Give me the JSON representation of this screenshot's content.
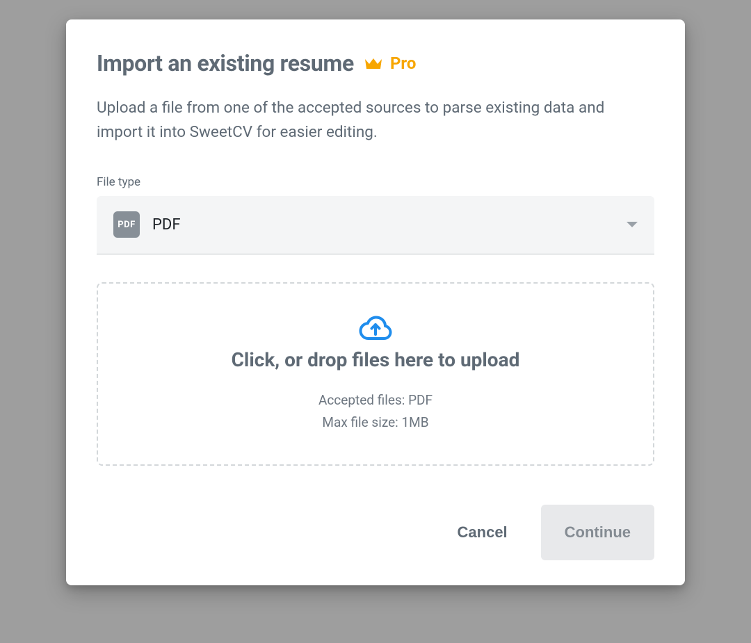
{
  "modal": {
    "title": "Import an existing resume",
    "pro_badge": "Pro",
    "description": "Upload a file from one of the accepted sources to parse existing data and import it into SweetCV for easier editing.",
    "file_type_label": "File type",
    "file_type_value": "PDF",
    "pdf_badge": "PDF",
    "dropzone": {
      "title": "Click, or drop files here to upload",
      "accepted": "Accepted files: PDF",
      "max_size": "Max file size: 1MB"
    },
    "buttons": {
      "cancel": "Cancel",
      "continue": "Continue"
    }
  }
}
